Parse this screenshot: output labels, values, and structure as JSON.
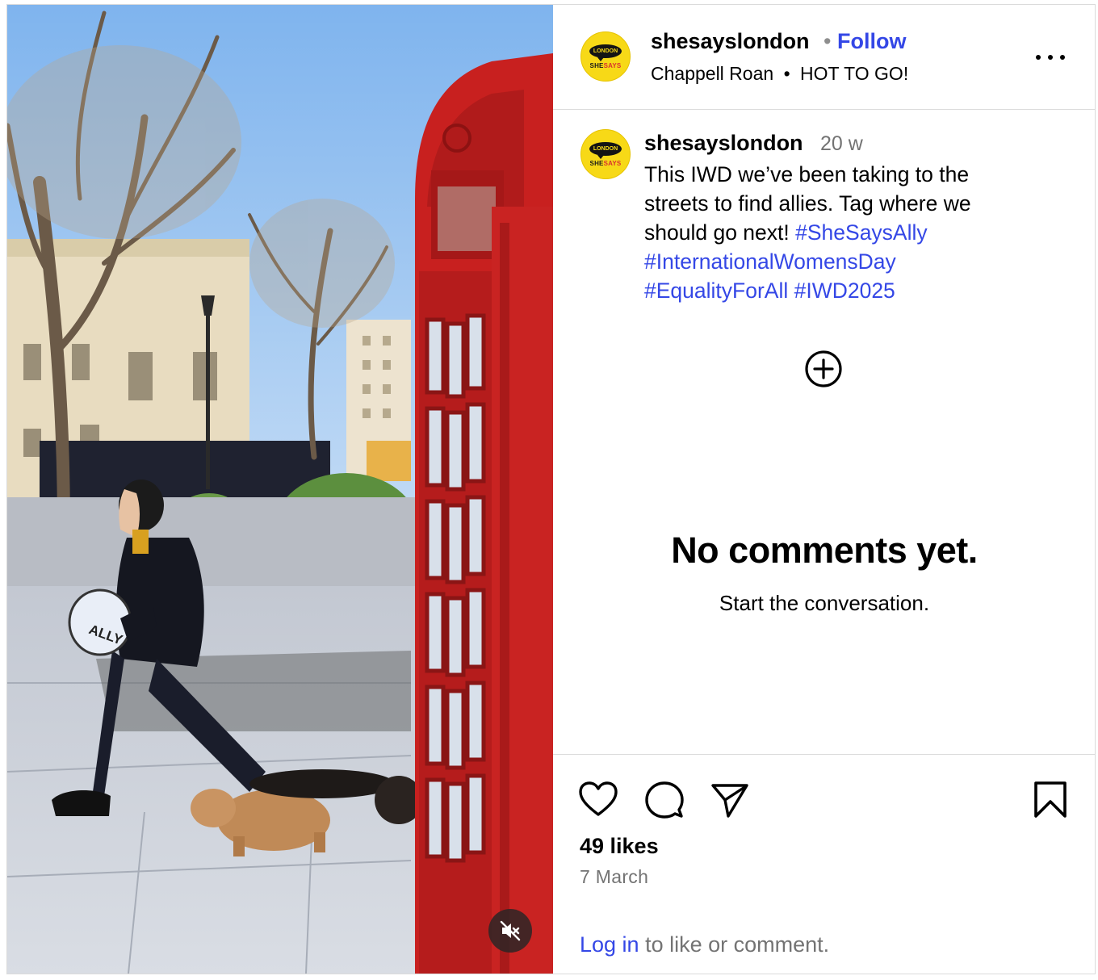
{
  "media": {
    "signboard_text": "ALLY",
    "mute_icon": "speaker-muted-icon"
  },
  "header": {
    "username": "shesayslondon",
    "separator": "•",
    "follow_label": "Follow",
    "audio_artist": "Chappell Roan",
    "audio_separator": "•",
    "audio_track": "HOT TO GO!",
    "more_icon": "more-options-icon"
  },
  "avatar": {
    "bubble_text": "LONDON",
    "brand_she": "SHE",
    "brand_says": "SAYS"
  },
  "caption": {
    "username": "shesayslondon",
    "time": "20 w",
    "text": "This IWD we’ve been taking to the streets to find allies. Tag where we should go next!",
    "hashtags": [
      "#SheSaysAlly",
      "#InternationalWomensDay",
      "#EqualityForAll",
      "#IWD2025"
    ]
  },
  "comments": {
    "empty_title": "No comments yet.",
    "empty_subtitle": "Start the conversation."
  },
  "footer": {
    "likes": "49 likes",
    "date": "7 March",
    "login_link": "Log in",
    "login_rest": " to like or comment."
  },
  "colors": {
    "link_blue": "#3447e6",
    "muted_gray": "#737373",
    "border": "#dbdbdb",
    "phone_box_red": "#c8201f",
    "avatar_yellow": "#f7d917"
  }
}
